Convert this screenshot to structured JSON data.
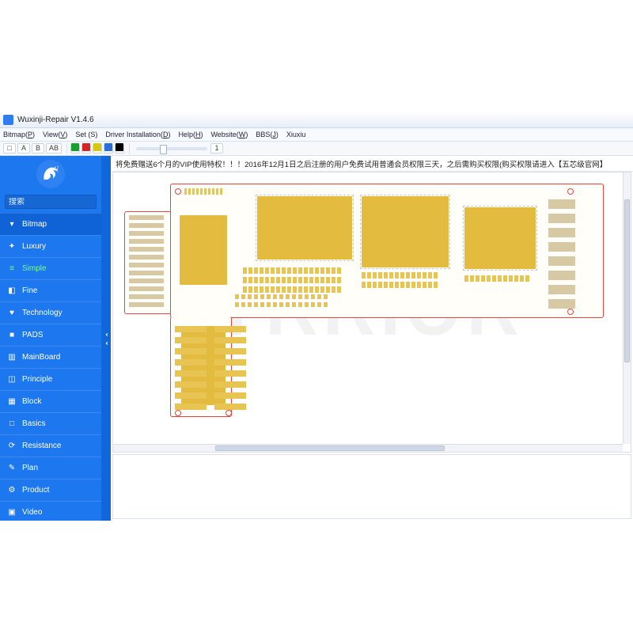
{
  "window": {
    "title": "Wuxinji-Repair V1.4.6"
  },
  "menus": [
    {
      "label": "Bitmap",
      "accel": "P"
    },
    {
      "label": "View",
      "accel": "V"
    },
    {
      "label": "Set (S)",
      "accel": ""
    },
    {
      "label": "Driver Installation",
      "accel": "D"
    },
    {
      "label": "Help",
      "accel": "H"
    },
    {
      "label": "Website",
      "accel": "W"
    },
    {
      "label": "BBS",
      "accel": "J"
    },
    {
      "label": "Xiuxiu",
      "accel": ""
    }
  ],
  "toolbar": {
    "rect_label": "□",
    "a1": "A",
    "b": "B",
    "ab": "AB",
    "swatches": [
      "#17a02f",
      "#d4252b",
      "#d6c80e",
      "#2c6fd8",
      "#000000"
    ],
    "size_label": "1"
  },
  "sidebar": {
    "search_placeholder": "搜索",
    "items": [
      {
        "icon": "▾",
        "label": "Bitmap",
        "name": "sidebar-item-bitmap",
        "active": true
      },
      {
        "icon": "✦",
        "label": "Luxury",
        "name": "sidebar-item-luxury"
      },
      {
        "icon": "≡",
        "label": "Simple",
        "name": "sidebar-item-simple",
        "simple": true
      },
      {
        "icon": "◧",
        "label": "Fine",
        "name": "sidebar-item-fine"
      },
      {
        "icon": "♥",
        "label": "Technology",
        "name": "sidebar-item-technology"
      },
      {
        "icon": "■",
        "label": "PADS",
        "name": "sidebar-item-pads"
      },
      {
        "icon": "▥",
        "label": "MainBoard",
        "name": "sidebar-item-mainboard"
      },
      {
        "icon": "◫",
        "label": "Principle",
        "name": "sidebar-item-principle"
      },
      {
        "icon": "▦",
        "label": "Block",
        "name": "sidebar-item-block"
      },
      {
        "icon": "□",
        "label": "Basics",
        "name": "sidebar-item-basics"
      },
      {
        "icon": "⟳",
        "label": "Resistance",
        "name": "sidebar-item-resistance"
      },
      {
        "icon": "✎",
        "label": "Plan",
        "name": "sidebar-item-plan"
      },
      {
        "icon": "⚙",
        "label": "Product",
        "name": "sidebar-item-product"
      },
      {
        "icon": "▣",
        "label": "Video",
        "name": "sidebar-item-video"
      }
    ]
  },
  "banner": "将免费赠送6个月的VIP使用特权！！！2016年12月1日之后注册的用户免费试用普通会员权限三天，之后需购买权限(购买权限请进入【五芯级官网】",
  "watermark": "YRRIOR"
}
